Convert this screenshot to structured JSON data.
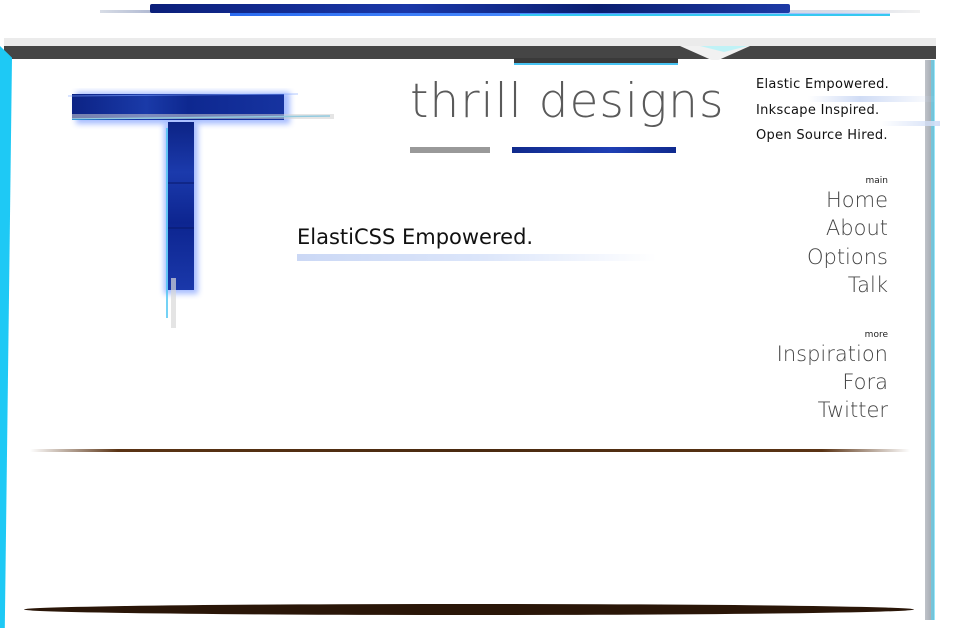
{
  "brand": {
    "title": "thrill designs"
  },
  "taglines": [
    "Elastic Empowered.",
    "Inkscape Inspired.",
    "Open Source Hired."
  ],
  "nav": {
    "main": {
      "heading": "main",
      "links": [
        "Home",
        "About",
        "Options",
        "Talk"
      ]
    },
    "more": {
      "heading": "more",
      "links": [
        "Inspiration",
        "Fora",
        "Twitter"
      ]
    }
  },
  "hero": {
    "headline": "ElastiCSS Empowered."
  },
  "colors": {
    "accent_blue": "#102a8c",
    "accent_cyan": "#1ec9f5",
    "header_dark": "#454545",
    "divider_brown": "#4a2a10"
  },
  "icons": {
    "logo": "letter-t-logo"
  }
}
